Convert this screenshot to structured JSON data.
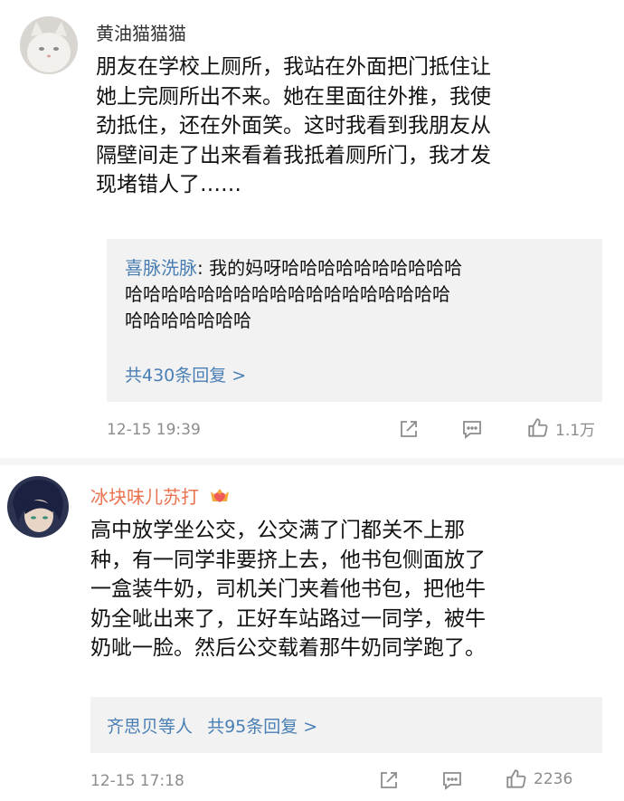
{
  "comments": [
    {
      "username": "黄油猫猫猫",
      "text_lines": [
        "朋友在学校上厕所，我站在外面把门抵住让",
        "她上完厕所出不来。她在里面往外推，我使",
        "劲抵住，还在外面笑。这时我看到我朋友从",
        "隔壁间走了出来看着我抵着厕所门，我才发",
        "现堵错人了……"
      ],
      "reply": {
        "author": "喜脉洗脉",
        "separator": ": ",
        "lines": [
          "我的妈呀哈哈哈哈哈哈哈哈哈哈",
          "哈哈哈哈哈哈哈哈哈哈哈哈哈哈哈哈哈哈",
          "哈哈哈哈哈哈哈"
        ],
        "more": "共430条回复 >"
      },
      "timestamp": "12-15 19:39",
      "likes": "1.1万"
    },
    {
      "username": "冰块味儿苏打",
      "badge_icon": "crown-heart-icon",
      "text_lines": [
        "高中放学坐公交，公交满了门都关不上那",
        "种，有一同学非要挤上去，他书包侧面放了",
        "一盒装牛奶，司机关门夹着他书包，把他牛",
        "奶全呲出来了，正好车站路过一同学，被牛",
        "奶呲一脸。然后公交载着那牛奶同学跑了。"
      ],
      "reply": {
        "author": "齐思贝等人",
        "more": "共95条回复 >"
      },
      "timestamp": "12-15 17:18",
      "likes": "2236"
    }
  ],
  "colors": {
    "username_plain": "#333333",
    "username_vip": "#eb7350",
    "link": "#4a7fb5",
    "meta": "#8c8c8c",
    "reply_bg": "#f2f2f2"
  }
}
